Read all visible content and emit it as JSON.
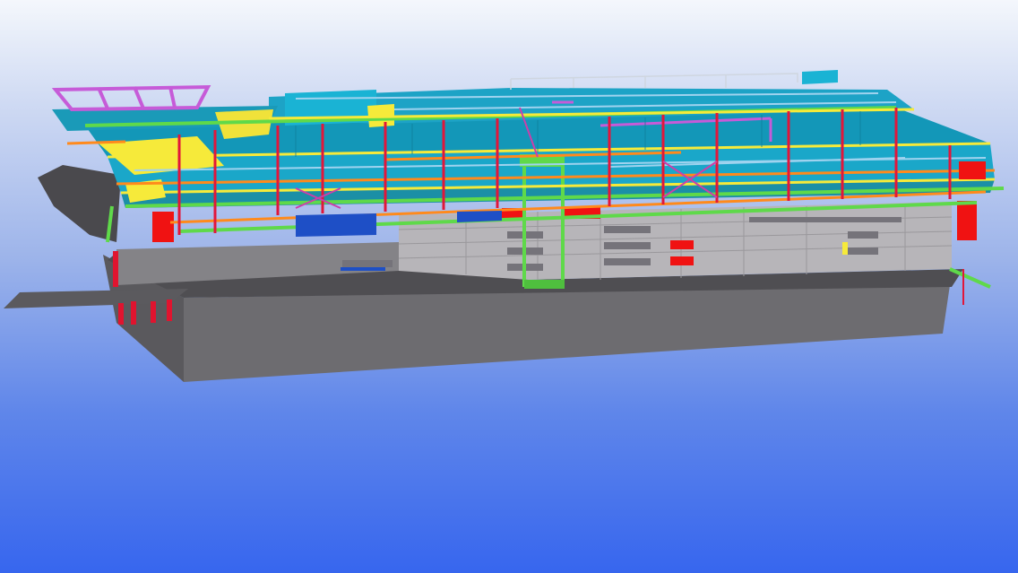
{
  "viewport": {
    "background_top": "#f4f7fc",
    "background_bottom": "#3766ee"
  },
  "model": {
    "colors": {
      "concrete": "#6f6f73",
      "concrete_dark": "#58585c",
      "concrete_light": "#8b8a8e",
      "wall_panel": "#b5b3b7",
      "slab_cyan": "#1aa7c9",
      "slab_teal": "#1b8fa6",
      "beam_yellow": "#f6ea3a",
      "beam_green": "#5fd94a",
      "beam_orange": "#ff8a1c",
      "column_red": "#e2163a",
      "column_magenta": "#cc3faa",
      "purple_frame": "#c65bd8",
      "blue_panel": "#1e4fc6",
      "red_panel": "#f01212",
      "light_blue_beam": "#9fd3ef"
    }
  }
}
